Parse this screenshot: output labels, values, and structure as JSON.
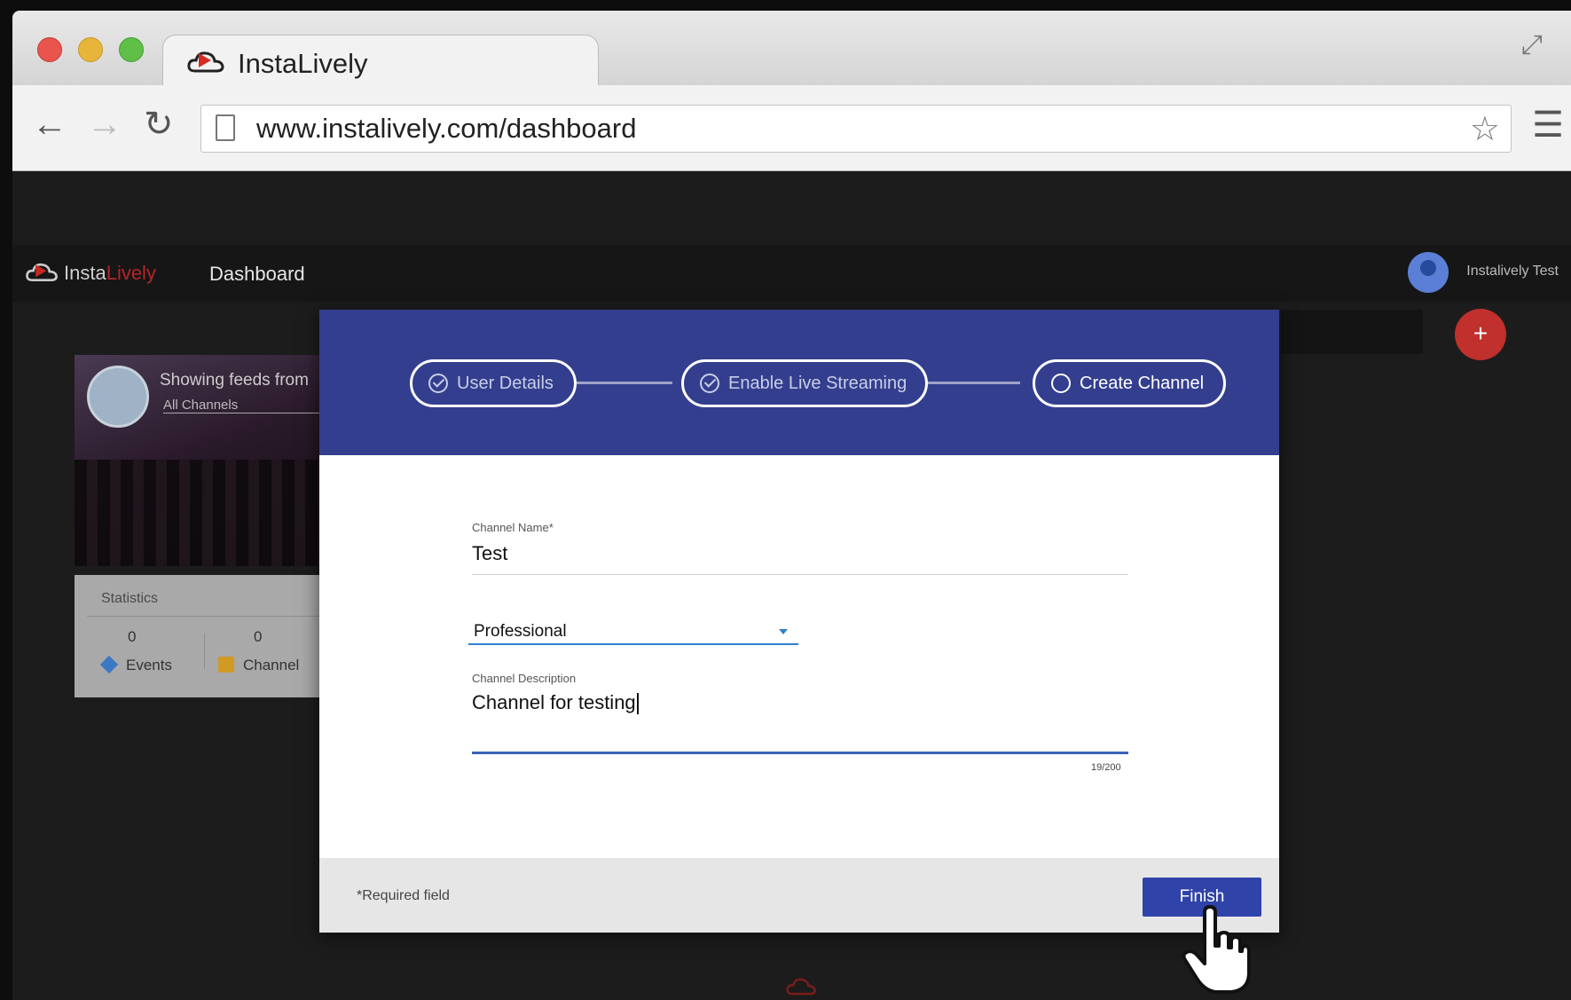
{
  "browser": {
    "tab_title": "InstaLively",
    "url": "www.instalively.com/dashboard"
  },
  "app": {
    "brand_part1": "Insta",
    "brand_part2": "Lively",
    "nav_dashboard": "Dashboard",
    "user_name": "Instalively Test",
    "fab_label": "+",
    "colors": {
      "brand_red": "#b52525",
      "modal_header": "#333f8e",
      "finish_button": "#2f43a8",
      "fab": "#c0302c"
    }
  },
  "feed_card": {
    "label": "Showing feeds from",
    "selected": "All Channels"
  },
  "stats": {
    "title": "Statistics",
    "events_value": "0",
    "events_label": "Events",
    "channels_value": "0",
    "channels_label": "Channel"
  },
  "stepper": {
    "steps": [
      {
        "label": "User Details",
        "state": "done"
      },
      {
        "label": "Enable Live Streaming",
        "state": "done"
      },
      {
        "label": "Create Channel",
        "state": "current"
      }
    ]
  },
  "form": {
    "channel_name_label": "Channel Name*",
    "channel_name_value": "Test",
    "category_value": "Professional",
    "description_label": "Channel Description",
    "description_value": "Channel for testing",
    "counter": "19/200",
    "required_note": "*Required field",
    "finish_label": "Finish"
  }
}
